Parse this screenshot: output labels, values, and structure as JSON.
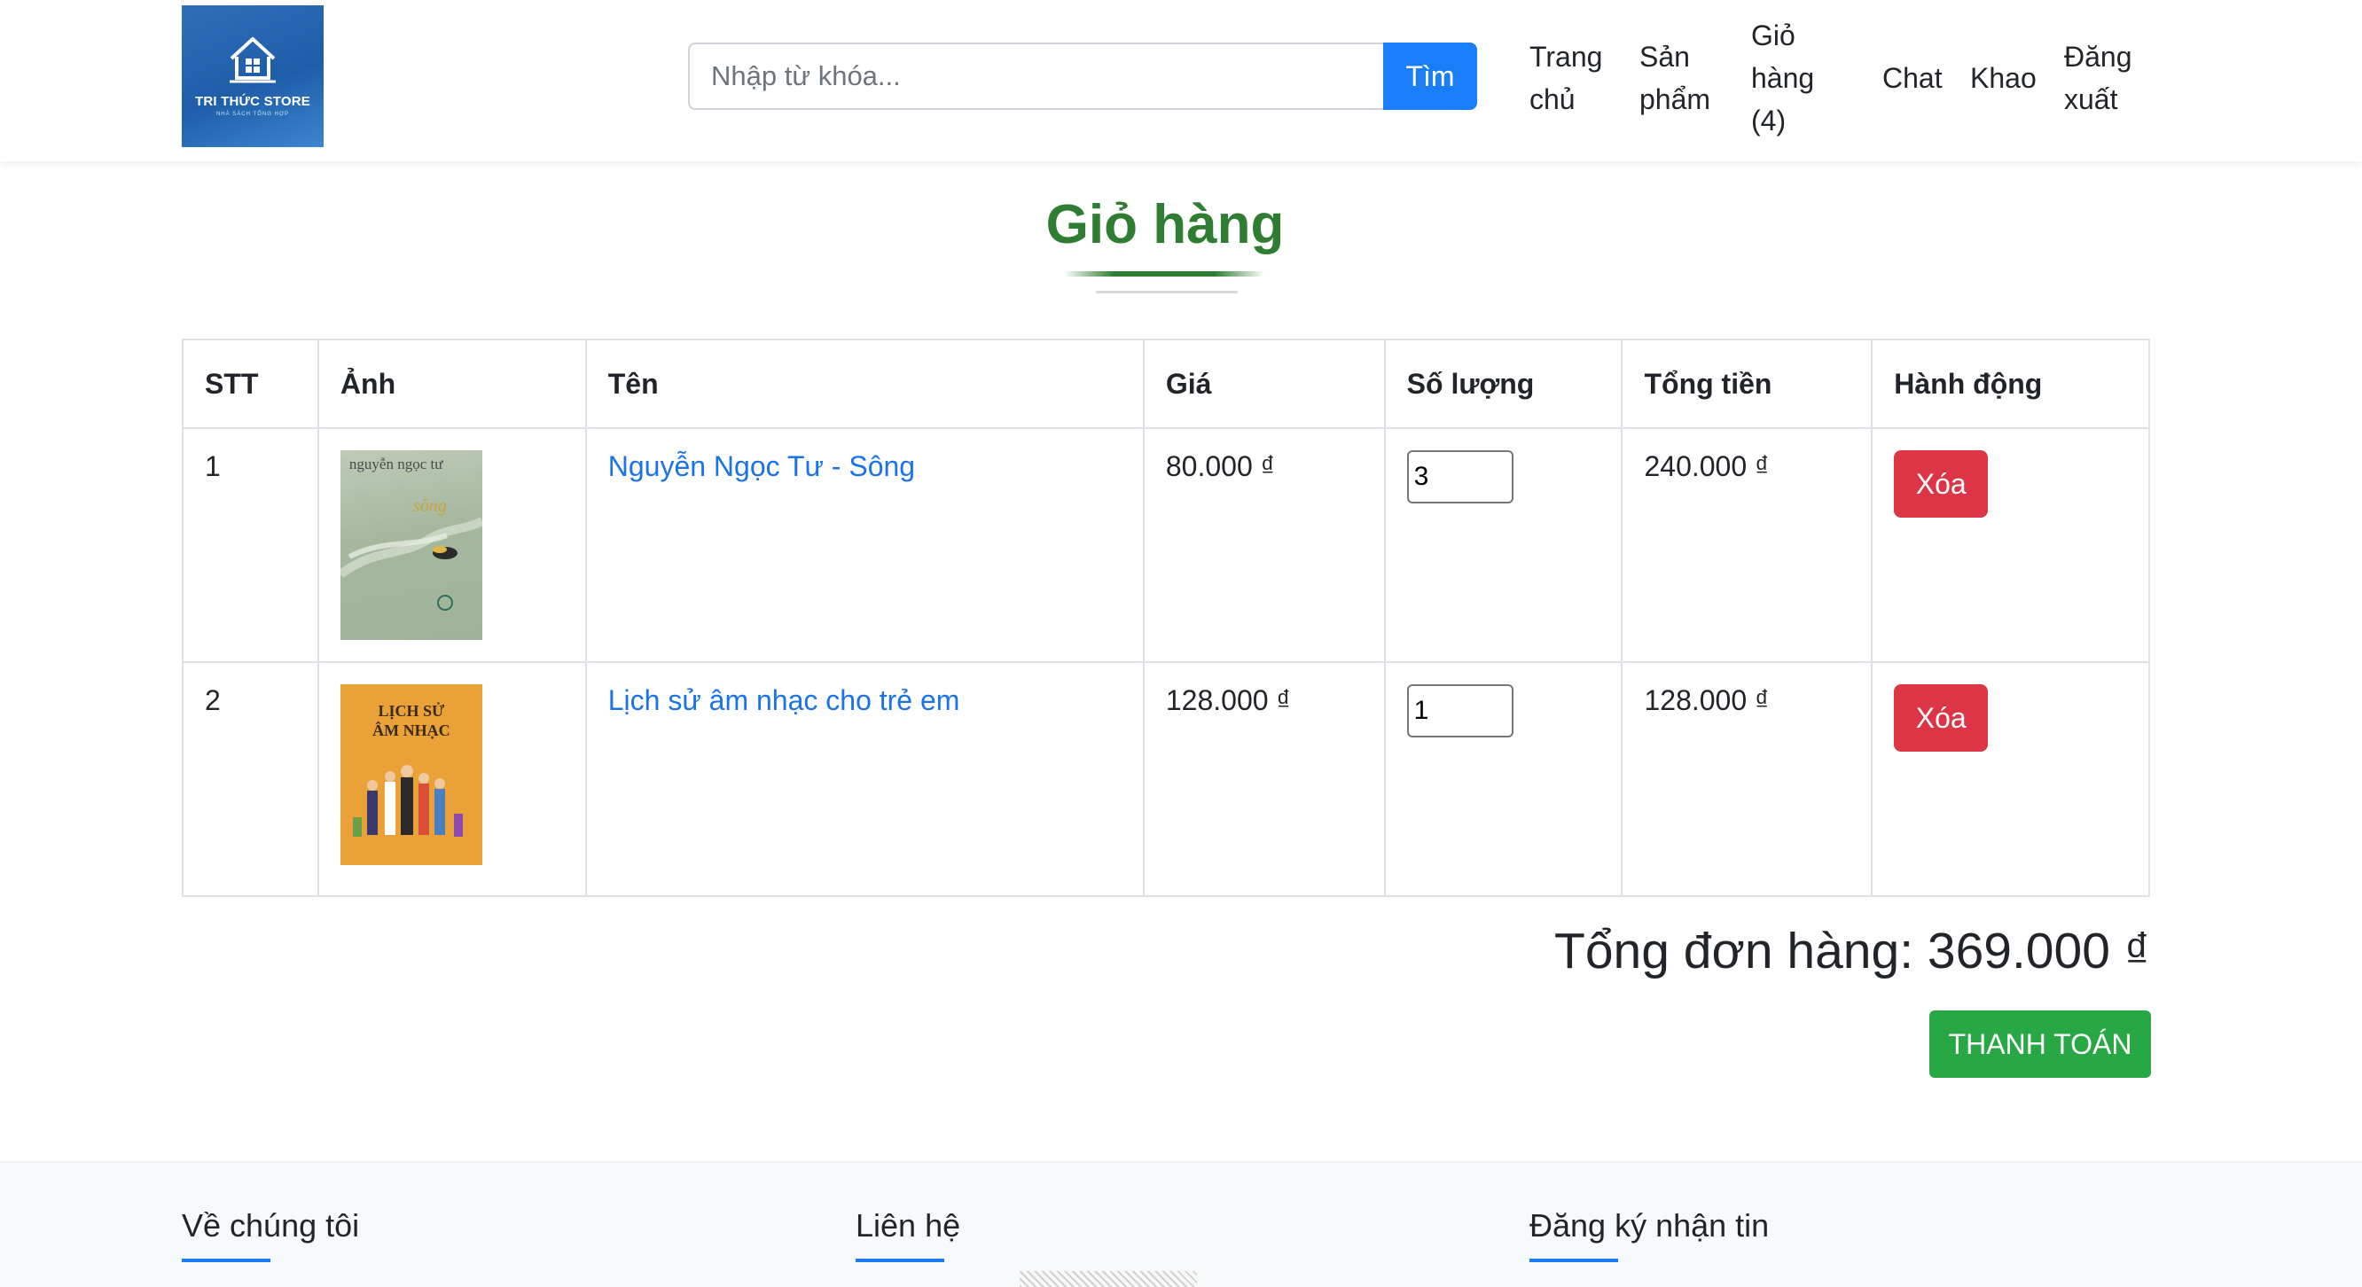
{
  "header": {
    "logo": {
      "brand": "TRI THỨC STORE",
      "tagline": "NHÀ SÁCH TỔNG HỢP",
      "color": "#1f5da8"
    },
    "search": {
      "placeholder": "Nhập từ khóa...",
      "button_label": "Tìm"
    },
    "nav": {
      "home": "Trang chủ",
      "products": "Sản phẩm",
      "cart": "Giỏ hàng (4)",
      "chat": "Chat",
      "khao": "Khao",
      "logout": "Đăng xuất"
    }
  },
  "page_title": "Giỏ hàng",
  "cart_table": {
    "headers": [
      "STT",
      "Ảnh",
      "Tên",
      "Giá",
      "Số lượng",
      "Tổng tiền",
      "Hành động"
    ],
    "rows": [
      {
        "stt": "1",
        "image": {
          "author_text": "nguyễn ngọc tư",
          "title_text": "sông"
        },
        "name": "Nguyễn Ngọc Tư - Sông",
        "price": "80.000 ₫",
        "quantity": "3",
        "total": "240.000 ₫",
        "action": "Xóa"
      },
      {
        "stt": "2",
        "image": {
          "title_line1": "LỊCH SỬ",
          "title_line2": "ÂM NHẠC"
        },
        "name": "Lịch sử âm nhạc cho trẻ em",
        "price": "128.000 ₫",
        "quantity": "1",
        "total": "128.000 ₫",
        "action": "Xóa"
      }
    ]
  },
  "order_total": "Tổng đơn hàng: 369.000 ₫",
  "checkout_label": "THANH TOÁN",
  "footer": {
    "about": "Về chúng tôi",
    "contact": "Liên hệ",
    "newsletter": "Đăng ký nhận tin"
  },
  "colors": {
    "accent_blue": "#1a7ef8",
    "title_green": "#2e7d32",
    "delete_red": "#dc3545",
    "checkout_green": "#28a745",
    "link_blue": "#1a73e8"
  },
  "icons": {
    "logo": "house-icon"
  }
}
